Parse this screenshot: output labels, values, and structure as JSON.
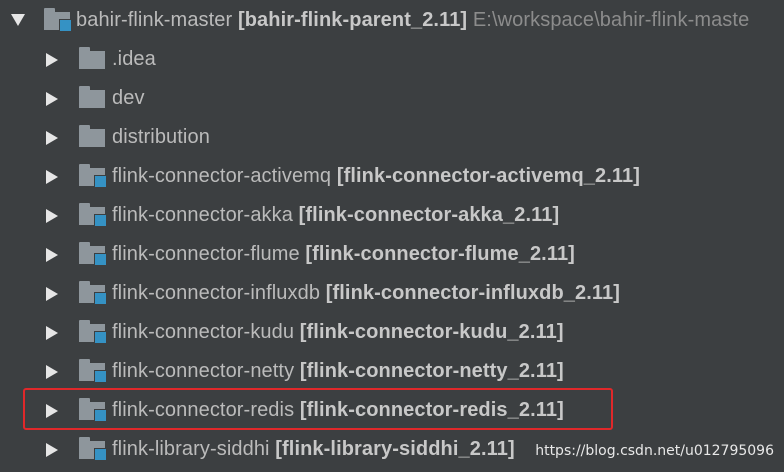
{
  "root": {
    "name": "bahir-flink-master",
    "module": "[bahir-flink-parent_2.11]",
    "path": "E:\\workspace\\bahir-flink-maste"
  },
  "items": [
    {
      "name": ".idea",
      "module": "",
      "icon": "folder-icon"
    },
    {
      "name": "dev",
      "module": "",
      "icon": "folder-icon"
    },
    {
      "name": "distribution",
      "module": "",
      "icon": "folder-icon"
    },
    {
      "name": "flink-connector-activemq",
      "module": "[flink-connector-activemq_2.11]",
      "icon": "module-folder-icon"
    },
    {
      "name": "flink-connector-akka",
      "module": "[flink-connector-akka_2.11]",
      "icon": "module-folder-icon"
    },
    {
      "name": "flink-connector-flume",
      "module": "[flink-connector-flume_2.11]",
      "icon": "module-folder-icon"
    },
    {
      "name": "flink-connector-influxdb",
      "module": "[flink-connector-influxdb_2.11]",
      "icon": "module-folder-icon"
    },
    {
      "name": "flink-connector-kudu",
      "module": "[flink-connector-kudu_2.11]",
      "icon": "module-folder-icon"
    },
    {
      "name": "flink-connector-netty",
      "module": "[flink-connector-netty_2.11]",
      "icon": "module-folder-icon"
    },
    {
      "name": "flink-connector-redis",
      "module": "[flink-connector-redis_2.11]",
      "icon": "module-folder-icon"
    },
    {
      "name": "flink-library-siddhi",
      "module": "[flink-library-siddhi_2.11]",
      "icon": "module-folder-icon"
    }
  ],
  "watermark": "https://blog.csdn.net/u012795096",
  "colors": {
    "background": "#3c3f41",
    "text": "#bbbbbb",
    "folder": "#8e969c",
    "module_badge": "#3592c4",
    "highlight": "#e0282a"
  }
}
